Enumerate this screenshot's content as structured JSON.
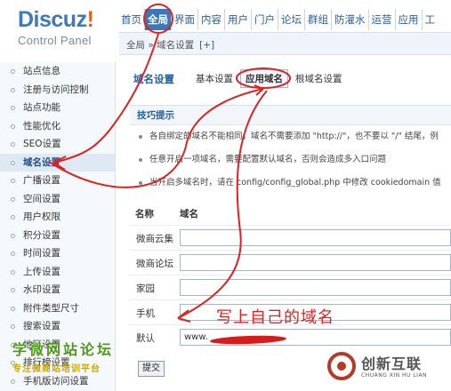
{
  "logo": {
    "title_main": "Discuz",
    "title_mark": "!",
    "subtitle": "Control Panel"
  },
  "topnav": {
    "items": [
      {
        "label": "首页",
        "active": false
      },
      {
        "label": "全局",
        "active": true
      },
      {
        "label": "界面",
        "active": false
      },
      {
        "label": "内容",
        "active": false
      },
      {
        "label": "用户",
        "active": false
      },
      {
        "label": "门户",
        "active": false
      },
      {
        "label": "论坛",
        "active": false
      },
      {
        "label": "群组",
        "active": false
      },
      {
        "label": "防灌水",
        "active": false
      },
      {
        "label": "运营",
        "active": false
      },
      {
        "label": "应用",
        "active": false
      },
      {
        "label": "工",
        "active": false
      }
    ]
  },
  "breadcrumb": {
    "text": "全局 » 域名设置",
    "plus": "[+]"
  },
  "sidebar": {
    "items": [
      {
        "label": "站点信息",
        "active": false
      },
      {
        "label": "注册与访问控制",
        "active": false
      },
      {
        "label": "站点功能",
        "active": false
      },
      {
        "label": "性能优化",
        "active": false
      },
      {
        "label": "SEO设置",
        "active": false
      },
      {
        "label": "域名设置",
        "active": true
      },
      {
        "label": "广播设置",
        "active": false
      },
      {
        "label": "空间设置",
        "active": false
      },
      {
        "label": "用户权限",
        "active": false
      },
      {
        "label": "积分设置",
        "active": false
      },
      {
        "label": "时间设置",
        "active": false
      },
      {
        "label": "上传设置",
        "active": false
      },
      {
        "label": "水印设置",
        "active": false
      },
      {
        "label": "附件类型尺寸",
        "active": false
      },
      {
        "label": "搜索设置",
        "active": false
      },
      {
        "label": "地区设置",
        "active": false
      },
      {
        "label": "排行榜设置",
        "active": false
      },
      {
        "label": "手机版访问设置",
        "active": false
      }
    ]
  },
  "main": {
    "title": "域名设置",
    "tabs": [
      {
        "label": "基本设置",
        "active": false
      },
      {
        "label": "应用域名",
        "active": true
      },
      {
        "label": "根域名设置",
        "active": false
      }
    ],
    "tips_title": "技巧提示",
    "tips": [
      "各自绑定的域名不能相同，域名不需要添加 \"http://\"，也不要以 \"/\" 结尾，例",
      "任意开启一项域名，需要配置默认域名，否则会造成多入口问题",
      "当开启多域名时，请在 config/config_global.php 中修改 cookiedomain 值"
    ],
    "col_name": "名称",
    "col_domain": "域名",
    "rows": [
      {
        "label": "微商云集",
        "value": ""
      },
      {
        "label": "微商论坛",
        "value": ""
      },
      {
        "label": "家园",
        "value": ""
      },
      {
        "label": "手机",
        "value": ""
      },
      {
        "label": "默认",
        "value": "www."
      }
    ],
    "submit_label": "提交"
  },
  "annotation": {
    "text": "写上自己的域名",
    "color": "#dd2222"
  },
  "watermarks": {
    "left_main": "学微网站论坛",
    "left_sub": "专注微商站培训平台",
    "right_name": "创新互联",
    "right_sub": "CHUANG XIN HU LIAN"
  },
  "colors": {
    "brand_blue": "#3b78b9",
    "link_blue": "#2b5d99",
    "annotation_red": "#dd2222"
  }
}
